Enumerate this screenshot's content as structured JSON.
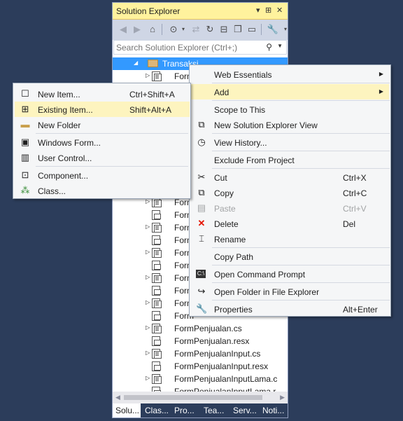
{
  "solution_explorer": {
    "title": "Solution Explorer",
    "title_controls": [
      "▾",
      "⊞",
      "✕"
    ],
    "search_placeholder": "Search Solution Explorer (Ctrl+;)",
    "tree": [
      {
        "label": "Transaksi",
        "type": "folder",
        "selected": true
      },
      {
        "label": "FormP",
        "type": "form"
      },
      {
        "label": "",
        "type": "res"
      },
      {
        "label": "",
        "type": "form"
      },
      {
        "label": "",
        "type": "res"
      },
      {
        "label": "",
        "type": "form"
      },
      {
        "label": "",
        "type": "res"
      },
      {
        "label": "",
        "type": "form"
      },
      {
        "label": "",
        "type": "res"
      },
      {
        "label": "",
        "type": "form"
      },
      {
        "label": "",
        "type": "res"
      },
      {
        "label": "Form",
        "type": "form"
      },
      {
        "label": "Form",
        "type": "res"
      },
      {
        "label": "Form",
        "type": "form"
      },
      {
        "label": "Form",
        "type": "res"
      },
      {
        "label": "Form",
        "type": "form"
      },
      {
        "label": "Form",
        "type": "res"
      },
      {
        "label": "Form",
        "type": "form"
      },
      {
        "label": "Form",
        "type": "res"
      },
      {
        "label": "Form",
        "type": "form"
      },
      {
        "label": "Form",
        "type": "res"
      },
      {
        "label": "FormPenjualan.cs",
        "type": "form"
      },
      {
        "label": "FormPenjualan.resx",
        "type": "res"
      },
      {
        "label": "FormPenjualanInput.cs",
        "type": "form"
      },
      {
        "label": "FormPenjualanInput.resx",
        "type": "res"
      },
      {
        "label": "FormPenjualanInputLama.c",
        "type": "form"
      },
      {
        "label": "FormPenjualanInputLama.r",
        "type": "res"
      }
    ],
    "tabs": [
      "Solu...",
      "Clas...",
      "Pro...",
      "Tea...",
      "Serv...",
      "Noti..."
    ]
  },
  "context_menu": {
    "web_essentials": "Web Essentials",
    "add": "Add",
    "scope_to_this": "Scope to This",
    "new_view": "New Solution Explorer View",
    "view_history": "View History...",
    "exclude": "Exclude From Project",
    "cut": "Cut",
    "cut_sc": "Ctrl+X",
    "copy": "Copy",
    "copy_sc": "Ctrl+C",
    "paste": "Paste",
    "paste_sc": "Ctrl+V",
    "delete": "Delete",
    "delete_sc": "Del",
    "rename": "Rename",
    "copy_path": "Copy Path",
    "open_cmd": "Open Command Prompt",
    "open_folder": "Open Folder in File Explorer",
    "properties": "Properties",
    "properties_sc": "Alt+Enter"
  },
  "add_submenu": {
    "new_item": "New Item...",
    "new_item_sc": "Ctrl+Shift+A",
    "existing_item": "Existing Item...",
    "existing_item_sc": "Shift+Alt+A",
    "new_folder": "New Folder",
    "windows_form": "Windows Form...",
    "user_control": "User Control...",
    "component": "Component...",
    "class": "Class..."
  },
  "colors": {
    "background": "#2c3d5b",
    "title": "#fff29d",
    "selection": "#3399ff",
    "highlight": "#fdf4bf"
  }
}
